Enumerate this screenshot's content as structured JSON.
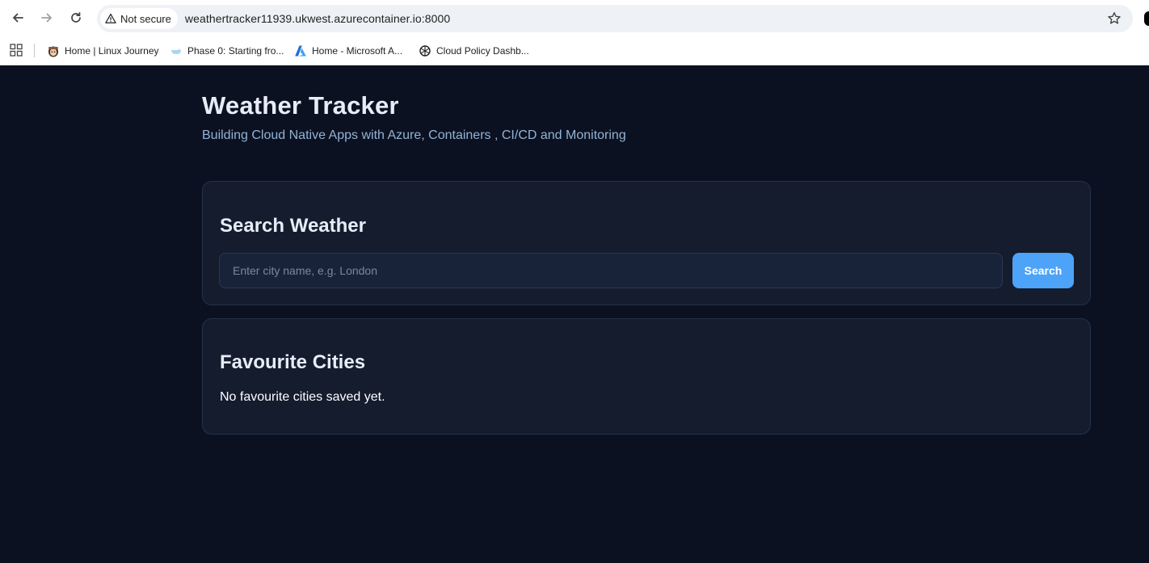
{
  "browser": {
    "security_label": "Not secure",
    "url": "weathertracker11939.ukwest.azurecontainer.io:8000",
    "bookmarks": [
      {
        "label": "Home | Linux Journey",
        "icon": "linux-journey-icon"
      },
      {
        "label": "Phase 0: Starting fro...",
        "icon": "docker-icon"
      },
      {
        "label": "Home - Microsoft A...",
        "icon": "azure-icon"
      },
      {
        "label": "Cloud Policy Dashb...",
        "icon": "openai-icon"
      }
    ]
  },
  "app": {
    "title": "Weather Tracker",
    "subtitle": "Building Cloud Native Apps with Azure, Containers , CI/CD and Monitoring"
  },
  "search": {
    "heading": "Search Weather",
    "placeholder": "Enter city name, e.g. London",
    "value": "",
    "button_label": "Search"
  },
  "favourites": {
    "heading": "Favourite Cities",
    "empty_message": "No favourite cities saved yet."
  },
  "colors": {
    "page_bg": "#0b1120",
    "card_bg": "#141c2e",
    "accent": "#4da3f7",
    "subtitle": "#93b3d6"
  }
}
